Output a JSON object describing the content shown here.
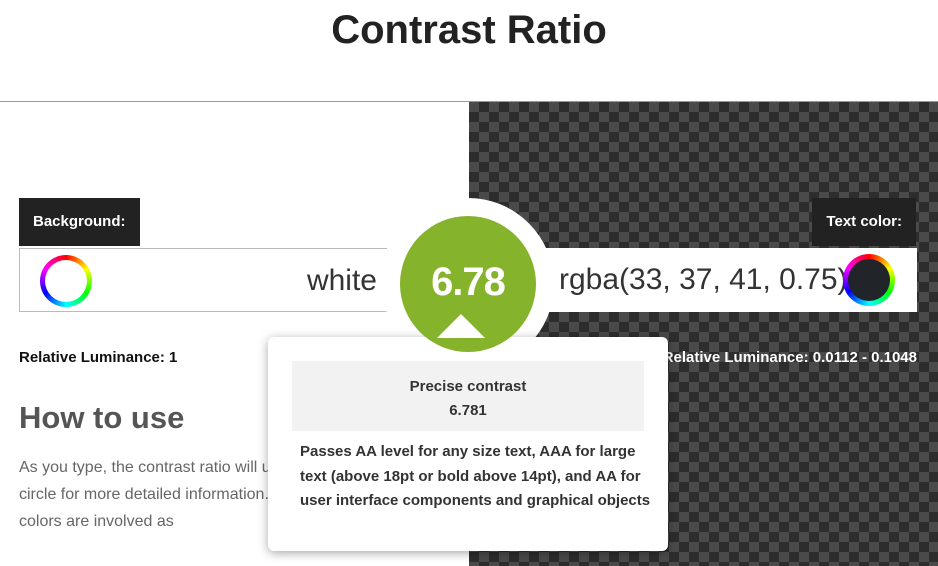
{
  "page": {
    "title": "Contrast Ratio"
  },
  "background": {
    "label": "Background:",
    "value": "white",
    "swatch_color": "#ffffff",
    "relative_luminance": "Relative Luminance: 1"
  },
  "text_color": {
    "label": "Text color:",
    "value": "rgba(33, 37, 41, 0.75)",
    "swatch_color": "#21252a",
    "relative_luminance": "Relative Luminance: 0.0112 - 0.1048"
  },
  "ratio": {
    "value": "6.78",
    "color": "#85b32b"
  },
  "tooltip": {
    "precise_label": "Precise contrast",
    "precise_value": "6.781",
    "pass_text": "Passes AA level for any size text, AAA for large text (above 18pt or bold above 14pt), and AA for user interface components and graphical objects"
  },
  "how_to_use": {
    "title": "How to use",
    "body": "As you type, the contrast ratio will update. Hover over the circle for more detailed information. When transparent colors are involved as"
  },
  "icons": [
    "color-wheel-icon"
  ]
}
